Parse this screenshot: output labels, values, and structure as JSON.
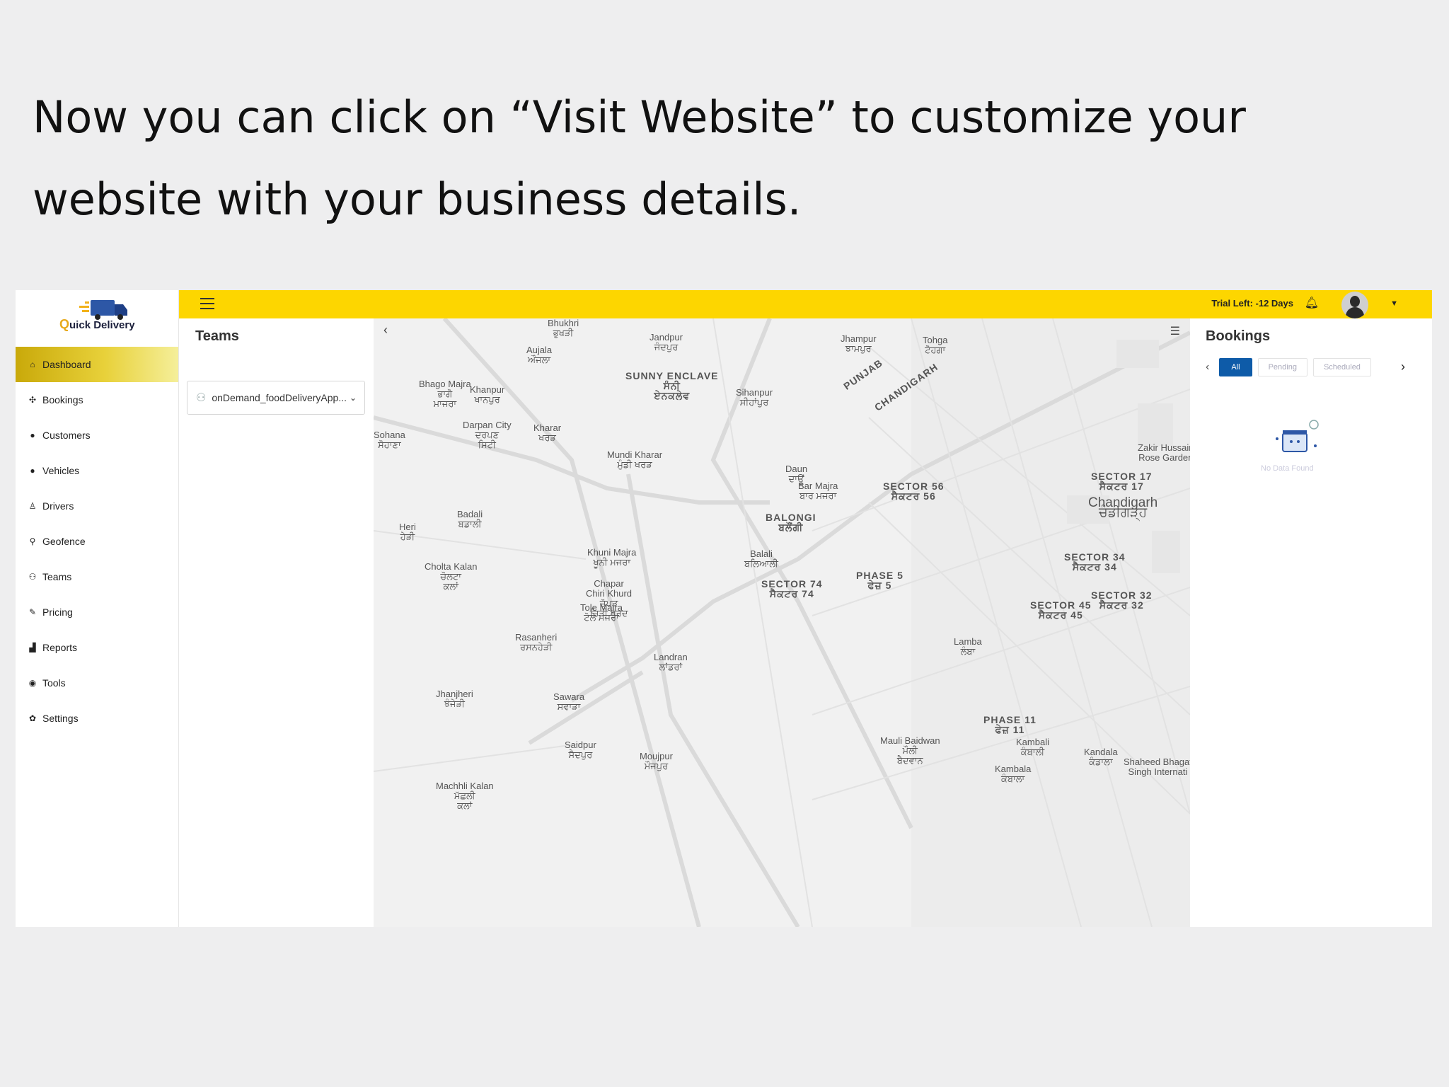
{
  "headline": {
    "line1": "Now you can click on “Visit Website” to customize your",
    "line2": "website with your business details."
  },
  "app": {
    "brand": {
      "q": "Q",
      "rest": "uick Delivery"
    },
    "topbar": {
      "trial": "Trial Left: -12 Days"
    },
    "sidebar": {
      "items": [
        {
          "label": "Dashboard",
          "icon": "home-icon",
          "glyph": "⌂"
        },
        {
          "label": "Bookings",
          "icon": "bookings-icon",
          "glyph": "✣"
        },
        {
          "label": "Customers",
          "icon": "user-icon",
          "glyph": "●"
        },
        {
          "label": "Vehicles",
          "icon": "vehicle-icon",
          "glyph": "●"
        },
        {
          "label": "Drivers",
          "icon": "driver-icon",
          "glyph": "♙"
        },
        {
          "label": "Geofence",
          "icon": "pin-icon",
          "glyph": "⚲"
        },
        {
          "label": "Teams",
          "icon": "team-icon",
          "glyph": "⚇"
        },
        {
          "label": "Pricing",
          "icon": "pricing-icon",
          "glyph": "✎"
        },
        {
          "label": "Reports",
          "icon": "chart-icon",
          "glyph": "▟"
        },
        {
          "label": "Tools",
          "icon": "tools-icon",
          "glyph": "◉"
        },
        {
          "label": "Settings",
          "icon": "gear-icon",
          "glyph": "✿"
        }
      ]
    },
    "teams": {
      "title": "Teams",
      "selected": "onDemand_foodDeliveryApp..."
    },
    "map": {
      "labels": [
        "Bhukhri\nਭੁਖੜੀ",
        "Jandpur\nਜੰਦਪੁਰ",
        "Aujala\nਔਜਲਾ",
        "Bhago Majra\nਭਾਗੋ\nਮਾਜਰਾ",
        "Khanpur\nਖਾਨਪੁਰ",
        "Darpan City\nਦਰਪਣ\nਸਿਟੀ",
        "Kharar\nਖਰੜ",
        "SUNNY ENCLAVE\nਸੰਨੀ\nਏਨਕਲੇਵ",
        "Sihanpur\nਸੀਹਾਂਪੁਰ",
        "Mundi Kharar\nਮੁੰਡੀ ਖਰੜ",
        "Jhampur\nਝਾਮਪੁਰ",
        "Tohga\nਟੋਹਗਾ",
        "PUNJAB",
        "CHANDIGARH",
        "Daun\nਦਾਊਂ",
        "Bar Majra\nਬਾਰ ਮਜਰਾ",
        "SECTOR 56\nਸੈਕਟਰ 56",
        "BALONGI\nਬਲੌਂਗੀ",
        "Badali\nਬਡਾਲੀ",
        "Heri\nਹੇੜੀ",
        "Sohana\nਸੋਹਾਣਾ",
        "Khuni Majra\nਖੂਨੀ ਮਜਰਾ",
        "Balali\nਬਲਿਆਲੀ",
        "Cholta Kalan\nਚੋਲਟਾ\nਕਲਾਂ",
        "Chapar\nChiri Khurd\nਚੱਪੜ\nਚਿੜੀ ਖੁਰਦ",
        "SECTOR 74\nਸੈਕਟਰ 74",
        "Tole Majra\nਟੋਲੇ ਮਜਰਾ",
        "Rasanheri\nਰਸਨਹੇੜੀ",
        "Landran\nਲਾਂਡਰਾਂ",
        "PHASE 5\nਫੇਜ਼ 5",
        "Lamba\nਲੰਬਾ",
        "Jhanjheri\nਝੰਜੇੜੀ",
        "Sawara\nਸਵਾੜਾ",
        "Saidpur\nਸੈਦਪੁਰ",
        "Moujpur\nਮੌਜਪੁਰ",
        "Machhli Kalan\nਮੱਛਲੀ\nਕਲਾਂ",
        "Mauli Baidwan\nਮੌਲੀ\nਬੈਦਵਾਨ",
        "Kambali\nਕੰਬਾਲੀ",
        "Kambala\nਕੰਬਾਲਾ",
        "Kandala\nਕੰਡਾਲਾ",
        "Shaheed Bhagat\nSingh Internati",
        "PHASE 11\nਫੇਜ਼ 11",
        "SECTOR 45\nਸੈਕਟਰ 45",
        "SECTOR 32\nਸੈਕਟਰ 32",
        "SECTOR 34\nਸੈਕਟਰ 34",
        "Chandigarh\nਚੰਡੀਗੜ੍ਹ",
        "SECTOR 17\nਸੈਕਟਰ 17",
        "Zakir Hussain\nRose Garden"
      ]
    },
    "bookings": {
      "title": "Bookings",
      "tabs": [
        "All",
        "Pending",
        "Scheduled"
      ],
      "empty": "No Data Found"
    }
  }
}
